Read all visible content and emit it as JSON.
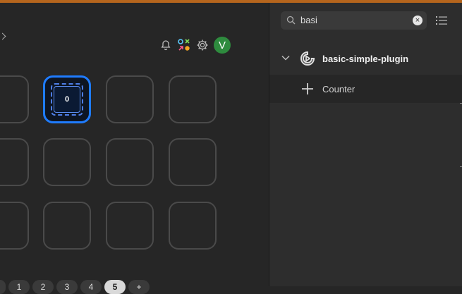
{
  "header": {
    "avatar_letter": "V"
  },
  "grid": {
    "active_key_value": "0"
  },
  "pagination": {
    "pages": [
      "1",
      "2",
      "3",
      "4",
      "5"
    ],
    "selected": "5",
    "add_label": "+"
  },
  "sidebar": {
    "search": {
      "value": "basi"
    },
    "plugin": {
      "name": "basic-simple-plugin",
      "actions": [
        {
          "label": "Counter"
        }
      ]
    }
  },
  "colors": {
    "accent": "#1f7cff",
    "avatar": "#2e8b3e",
    "top_strip": "#b5651d"
  }
}
